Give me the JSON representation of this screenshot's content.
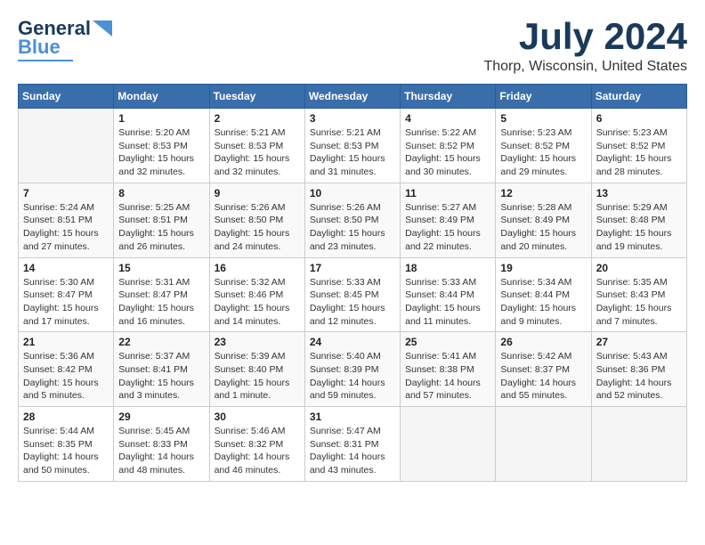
{
  "header": {
    "logo_general": "General",
    "logo_blue": "Blue",
    "title": "July 2024",
    "subtitle": "Thorp, Wisconsin, United States"
  },
  "calendar": {
    "days_of_week": [
      "Sunday",
      "Monday",
      "Tuesday",
      "Wednesday",
      "Thursday",
      "Friday",
      "Saturday"
    ],
    "weeks": [
      [
        {
          "day": "",
          "info": ""
        },
        {
          "day": "1",
          "info": "Sunrise: 5:20 AM\nSunset: 8:53 PM\nDaylight: 15 hours\nand 32 minutes."
        },
        {
          "day": "2",
          "info": "Sunrise: 5:21 AM\nSunset: 8:53 PM\nDaylight: 15 hours\nand 32 minutes."
        },
        {
          "day": "3",
          "info": "Sunrise: 5:21 AM\nSunset: 8:53 PM\nDaylight: 15 hours\nand 31 minutes."
        },
        {
          "day": "4",
          "info": "Sunrise: 5:22 AM\nSunset: 8:52 PM\nDaylight: 15 hours\nand 30 minutes."
        },
        {
          "day": "5",
          "info": "Sunrise: 5:23 AM\nSunset: 8:52 PM\nDaylight: 15 hours\nand 29 minutes."
        },
        {
          "day": "6",
          "info": "Sunrise: 5:23 AM\nSunset: 8:52 PM\nDaylight: 15 hours\nand 28 minutes."
        }
      ],
      [
        {
          "day": "7",
          "info": "Sunrise: 5:24 AM\nSunset: 8:51 PM\nDaylight: 15 hours\nand 27 minutes."
        },
        {
          "day": "8",
          "info": "Sunrise: 5:25 AM\nSunset: 8:51 PM\nDaylight: 15 hours\nand 26 minutes."
        },
        {
          "day": "9",
          "info": "Sunrise: 5:26 AM\nSunset: 8:50 PM\nDaylight: 15 hours\nand 24 minutes."
        },
        {
          "day": "10",
          "info": "Sunrise: 5:26 AM\nSunset: 8:50 PM\nDaylight: 15 hours\nand 23 minutes."
        },
        {
          "day": "11",
          "info": "Sunrise: 5:27 AM\nSunset: 8:49 PM\nDaylight: 15 hours\nand 22 minutes."
        },
        {
          "day": "12",
          "info": "Sunrise: 5:28 AM\nSunset: 8:49 PM\nDaylight: 15 hours\nand 20 minutes."
        },
        {
          "day": "13",
          "info": "Sunrise: 5:29 AM\nSunset: 8:48 PM\nDaylight: 15 hours\nand 19 minutes."
        }
      ],
      [
        {
          "day": "14",
          "info": "Sunrise: 5:30 AM\nSunset: 8:47 PM\nDaylight: 15 hours\nand 17 minutes."
        },
        {
          "day": "15",
          "info": "Sunrise: 5:31 AM\nSunset: 8:47 PM\nDaylight: 15 hours\nand 16 minutes."
        },
        {
          "day": "16",
          "info": "Sunrise: 5:32 AM\nSunset: 8:46 PM\nDaylight: 15 hours\nand 14 minutes."
        },
        {
          "day": "17",
          "info": "Sunrise: 5:33 AM\nSunset: 8:45 PM\nDaylight: 15 hours\nand 12 minutes."
        },
        {
          "day": "18",
          "info": "Sunrise: 5:33 AM\nSunset: 8:44 PM\nDaylight: 15 hours\nand 11 minutes."
        },
        {
          "day": "19",
          "info": "Sunrise: 5:34 AM\nSunset: 8:44 PM\nDaylight: 15 hours\nand 9 minutes."
        },
        {
          "day": "20",
          "info": "Sunrise: 5:35 AM\nSunset: 8:43 PM\nDaylight: 15 hours\nand 7 minutes."
        }
      ],
      [
        {
          "day": "21",
          "info": "Sunrise: 5:36 AM\nSunset: 8:42 PM\nDaylight: 15 hours\nand 5 minutes."
        },
        {
          "day": "22",
          "info": "Sunrise: 5:37 AM\nSunset: 8:41 PM\nDaylight: 15 hours\nand 3 minutes."
        },
        {
          "day": "23",
          "info": "Sunrise: 5:39 AM\nSunset: 8:40 PM\nDaylight: 15 hours\nand 1 minute."
        },
        {
          "day": "24",
          "info": "Sunrise: 5:40 AM\nSunset: 8:39 PM\nDaylight: 14 hours\nand 59 minutes."
        },
        {
          "day": "25",
          "info": "Sunrise: 5:41 AM\nSunset: 8:38 PM\nDaylight: 14 hours\nand 57 minutes."
        },
        {
          "day": "26",
          "info": "Sunrise: 5:42 AM\nSunset: 8:37 PM\nDaylight: 14 hours\nand 55 minutes."
        },
        {
          "day": "27",
          "info": "Sunrise: 5:43 AM\nSunset: 8:36 PM\nDaylight: 14 hours\nand 52 minutes."
        }
      ],
      [
        {
          "day": "28",
          "info": "Sunrise: 5:44 AM\nSunset: 8:35 PM\nDaylight: 14 hours\nand 50 minutes."
        },
        {
          "day": "29",
          "info": "Sunrise: 5:45 AM\nSunset: 8:33 PM\nDaylight: 14 hours\nand 48 minutes."
        },
        {
          "day": "30",
          "info": "Sunrise: 5:46 AM\nSunset: 8:32 PM\nDaylight: 14 hours\nand 46 minutes."
        },
        {
          "day": "31",
          "info": "Sunrise: 5:47 AM\nSunset: 8:31 PM\nDaylight: 14 hours\nand 43 minutes."
        },
        {
          "day": "",
          "info": ""
        },
        {
          "day": "",
          "info": ""
        },
        {
          "day": "",
          "info": ""
        }
      ]
    ]
  }
}
